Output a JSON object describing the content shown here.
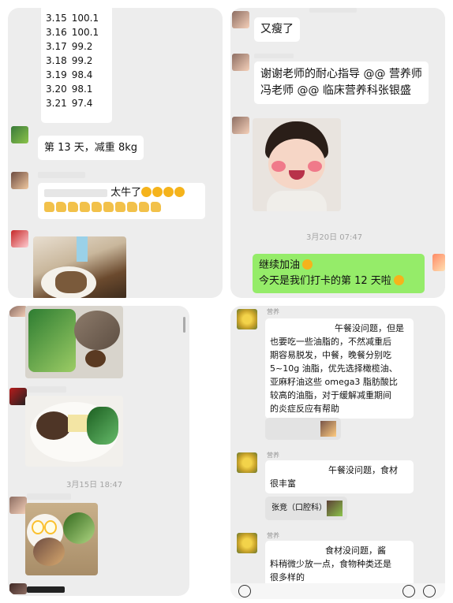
{
  "panel1": {
    "weights": [
      {
        "date": "3.15",
        "value": "100.1"
      },
      {
        "date": "3.16",
        "value": "100.1"
      },
      {
        "date": "3.17",
        "value": "99.2"
      },
      {
        "date": "3.18",
        "value": "99.2"
      },
      {
        "date": "3.19",
        "value": "98.4"
      },
      {
        "date": "3.20",
        "value": "98.1"
      },
      {
        "date": "3.21",
        "value": "97.4"
      }
    ],
    "day13_text": "第 13 天，减重 8kg",
    "praise_text": "太牛了"
  },
  "panel2": {
    "msg1": "又瘦了",
    "msg2_line1": "谢谢老师的耐心指导 @@ 营养师",
    "msg2_line2": "冯老师 @@ 临床营养科张银盛",
    "timestamp": "3月20日 07:47",
    "reply_line1": "继续加油",
    "reply_line2": "今天是我们打卡的第 12 天啦"
  },
  "panel3": {
    "timestamp": "3月15日 18:47"
  },
  "panel4": {
    "sender1_name": "营养",
    "reply1_lines": [
      "午餐没问题，但是",
      "也要吃一些油脂的，不然减重后",
      "期容易脱发，中餐，晚餐分别吃",
      "5~10g 油脂，优先选择橄榄油、",
      "亚麻籽油这些 omega3 脂肪酸比",
      "较高的油脂，对于缓解减重期间",
      "的炎症反应有帮助"
    ],
    "sender2_name": "营养",
    "reply2_lines": [
      "午餐没问题，食材",
      "很丰富"
    ],
    "quote2_label": "张竞（口腔科）:",
    "sender3_name": "营养",
    "reply3_lines": [
      "食材没问题，酱",
      "料稍微少放一点，食物种类还是",
      "很多样的"
    ]
  },
  "colors": {
    "panel_bg": "#ededed",
    "bubble": "#ffffff",
    "green_bubble": "#95ec69"
  }
}
